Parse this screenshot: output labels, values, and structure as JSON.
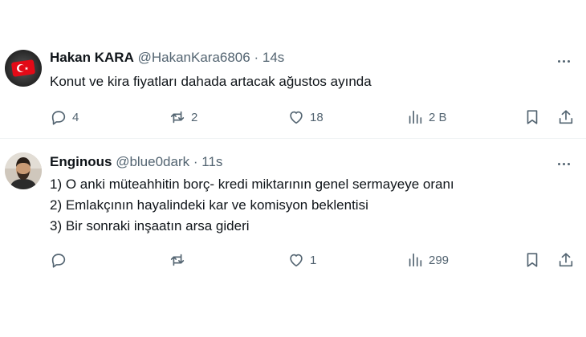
{
  "tweets": [
    {
      "name": "Hakan KARA",
      "handle": "@HakanKara6806",
      "separator": "·",
      "time": "14s",
      "lines": [
        "Konut ve kira fiyatları dahada artacak ağustos ayında"
      ],
      "replies": "4",
      "retweets": "2",
      "likes": "18",
      "views": "2 B",
      "avatar_icon": "turkish-flag-avatar"
    },
    {
      "name": "Enginous",
      "handle": "@blue0dark",
      "separator": "·",
      "time": "11s",
      "lines": [
        "1) O anki müteahhitin borç- kredi miktarının genel sermayeye oranı",
        "2) Emlakçının hayalindeki kar ve komisyon beklentisi",
        "3) Bir sonraki inşaatın arsa gideri"
      ],
      "replies": "",
      "retweets": "",
      "likes": "1",
      "views": "299",
      "avatar_icon": "bearded-man-avatar"
    }
  ],
  "colors": {
    "text": "#0f1419",
    "secondary": "#536471",
    "divider": "#eff3f4",
    "flag_red": "#e30a17"
  }
}
